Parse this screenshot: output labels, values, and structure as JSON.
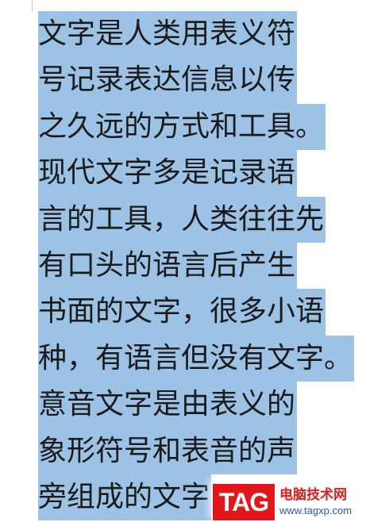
{
  "document": {
    "lines": [
      "文字是人类用表义符",
      "号记录表达信息以传",
      "之久远的方式和工具。",
      "现代文字多是记录语",
      "言的工具，人类往往先",
      "有口头的语言后产生",
      "书面的文字，很多小语",
      "种，有语言但没有文字。",
      "意音文字是由表义的",
      "象形符号和表音的声",
      "旁组成的文字"
    ],
    "selection_color": "#9cc3e5"
  },
  "watermark": {
    "logo": "TAG",
    "site_name": "电脑技术网",
    "url": "www.tagxp.com",
    "colors": {
      "logo_bg": "#e3161b",
      "title": "#d81e1e",
      "url": "#2a5caa"
    }
  }
}
